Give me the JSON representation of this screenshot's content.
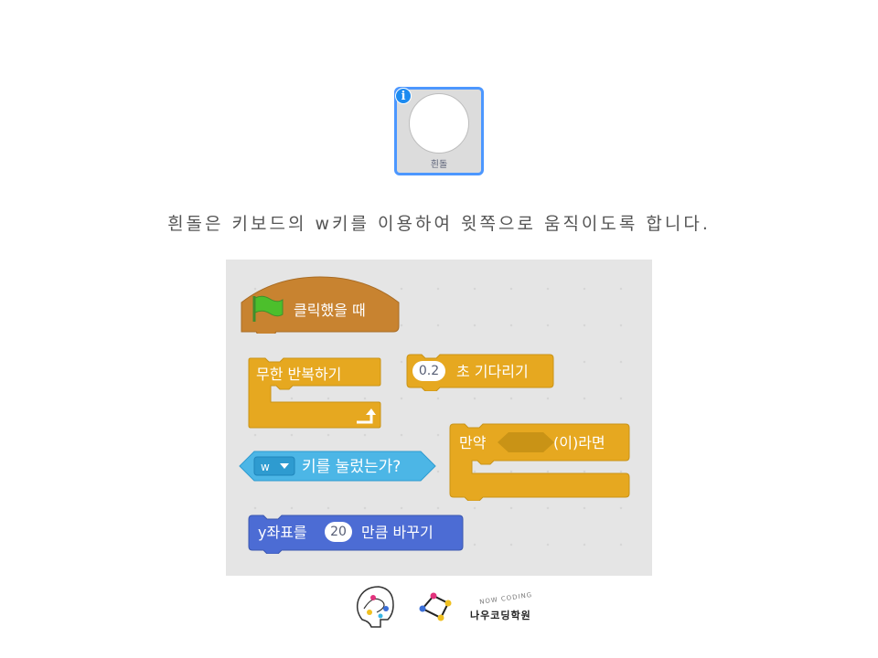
{
  "sprite": {
    "name": "흰돌",
    "info_glyph": "i",
    "thumbnail": "white-circle",
    "selected_border_color": "#4c97ff"
  },
  "instruction": "흰돌은 키보드의 w키를 이용하여 윗쪽으로 움직이도록 합니다.",
  "blocks": {
    "colors": {
      "events": "#c88330",
      "control": "#e6a820",
      "sensing": "#4cb6e6",
      "motion": "#4c6cd4"
    },
    "when_flag_clicked": {
      "label": "클릭했을 때",
      "icon": "green-flag"
    },
    "forever": {
      "label": "무한 반복하기",
      "icon": "loop-arrow"
    },
    "wait": {
      "value": "0.2",
      "label": "초 기다리기"
    },
    "if_then": {
      "prefix": "만약",
      "suffix": "(이)라면"
    },
    "key_pressed": {
      "key": "w",
      "label": "키를 눌렀는가?"
    },
    "change_y": {
      "prefix": "y좌표를",
      "value": "20",
      "suffix": "만큼 바꾸기"
    }
  },
  "logo": {
    "arc_text": "NOW CODING",
    "name": "나우코딩학원"
  }
}
